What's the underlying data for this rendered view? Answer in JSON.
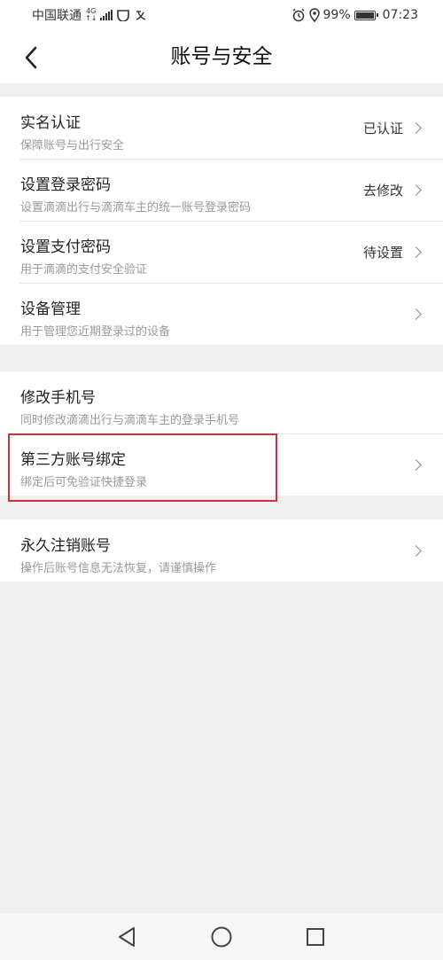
{
  "status_bar": {
    "carrier": "中国联通",
    "network_top": "4G",
    "network_bottom": "↑↓",
    "battery_percent": "99%",
    "time": "07:23"
  },
  "header": {
    "title": "账号与安全"
  },
  "sections": [
    {
      "rows": [
        {
          "title": "实名认证",
          "subtitle": "保障账号与出行安全",
          "value": "已认证"
        },
        {
          "title": "设置登录密码",
          "subtitle": "设置滴滴出行与滴滴车主的统一账号登录密码",
          "value": "去修改"
        },
        {
          "title": "设置支付密码",
          "subtitle": "用于滴滴的支付安全验证",
          "value": "待设置"
        },
        {
          "title": "设备管理",
          "subtitle": "用于管理您近期登录过的设备",
          "value": ""
        }
      ]
    },
    {
      "rows": [
        {
          "title": "修改手机号",
          "subtitle": "同时修改滴滴出行与滴滴车主的登录手机号",
          "value": ""
        },
        {
          "title": "第三方账号绑定",
          "subtitle": "绑定后可免验证快捷登录",
          "value": ""
        }
      ]
    },
    {
      "rows": [
        {
          "title": "永久注销账号",
          "subtitle": "操作后账号信息无法恢复，请谨慎操作",
          "value": ""
        }
      ]
    }
  ],
  "colors": {
    "highlight": "#d0313a",
    "background": "#f0f0f0",
    "card": "#ffffff"
  }
}
